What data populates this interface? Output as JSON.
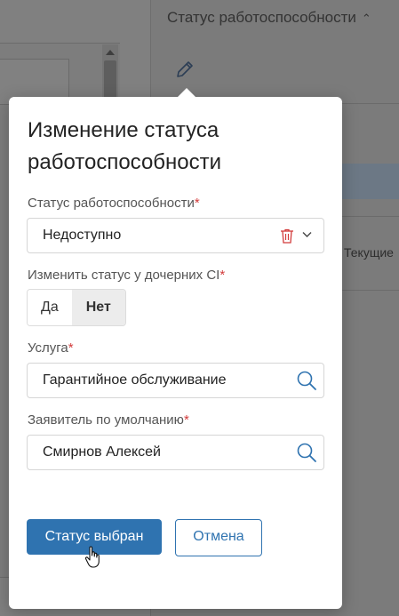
{
  "background": {
    "right_panel_title": "Статус работоспособности",
    "right_panel_chevron": "chevron-up-icon",
    "current_label": "Текущие"
  },
  "dialog": {
    "title": "Изменение статуса работоспособности",
    "status": {
      "label": "Статус работоспособности",
      "required_mark": "*",
      "value": "Недоступно"
    },
    "child_status": {
      "label": "Изменить статус у дочерних CI",
      "required_mark": "*",
      "options": [
        "Да",
        "Нет"
      ],
      "selected": "Нет"
    },
    "service": {
      "label": "Услуга",
      "required_mark": "*",
      "value": "Гарантийное обслуживание"
    },
    "applicant": {
      "label": "Заявитель по умолчанию",
      "required_mark": "*",
      "value": "Смирнов Алексей"
    },
    "buttons": {
      "confirm": "Статус выбран",
      "cancel": "Отмена"
    }
  },
  "colors": {
    "primary": "#2f73b0",
    "required": "#d23b3b",
    "overlay": "#7a7a7a"
  }
}
